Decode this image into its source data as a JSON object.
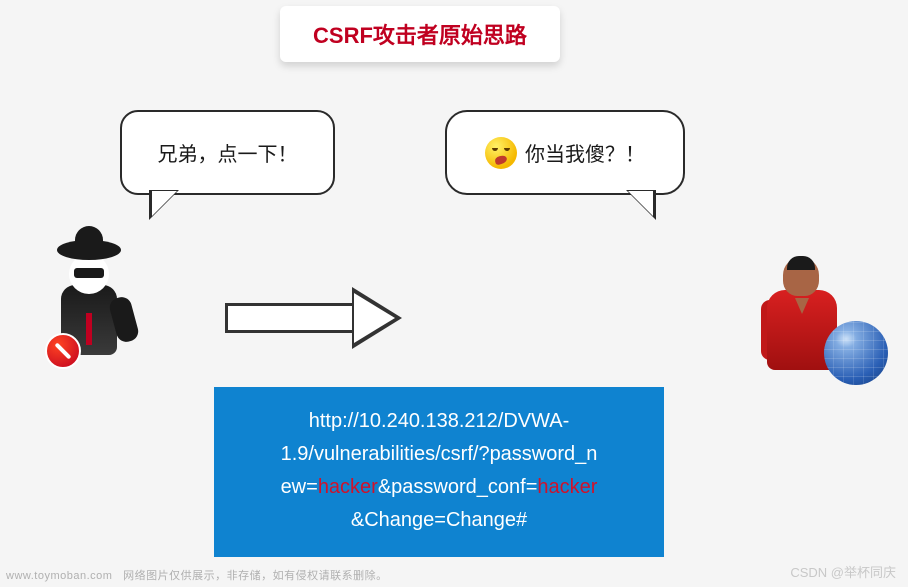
{
  "title": "CSRF攻击者原始思路",
  "speech_left": "兄弟，点一下！",
  "speech_right": "你当我傻？！",
  "url": {
    "p1": "http://10.240.138.212/DVWA-",
    "p2a": "1.9/vulnerabilities/csrf/?password_n",
    "p3a": "ew=",
    "p3b": "hacker",
    "p3c": "&password_conf=",
    "p3d": "hacker",
    "p4": "&Change=Change#"
  },
  "watermark_left_site": "www.toymoban.com",
  "watermark_left_text": "网络图片仅供展示，非存储，如有侵权请联系删除。",
  "watermark_right": "CSDN @举杯同庆"
}
